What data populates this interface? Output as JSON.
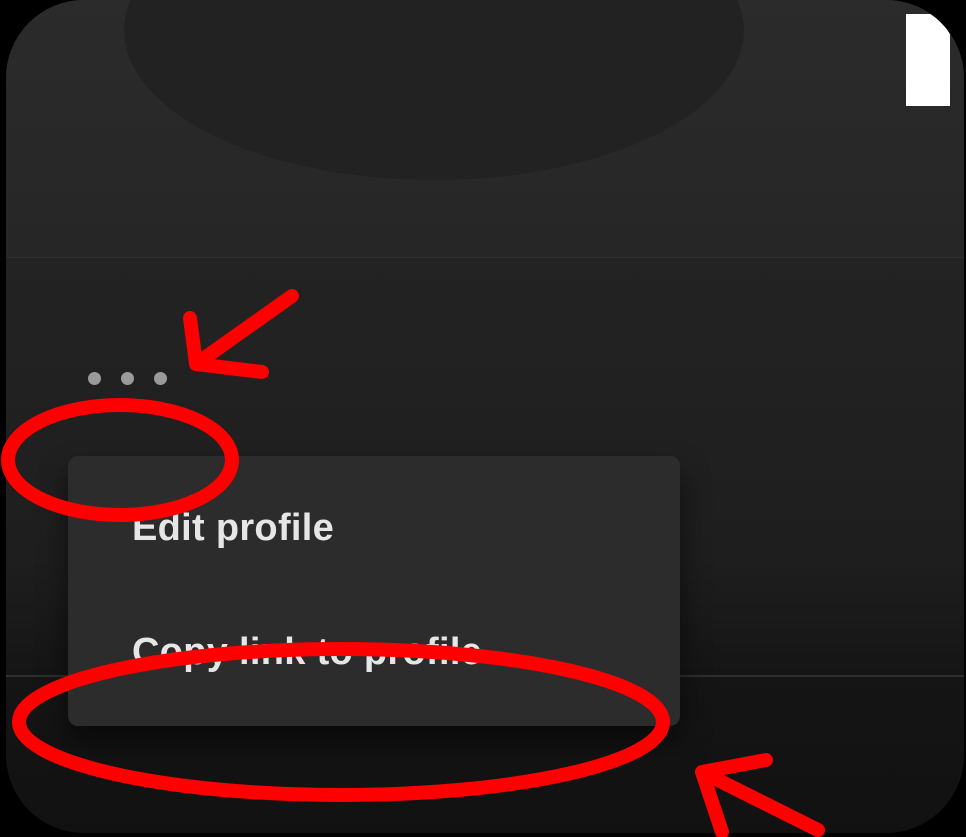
{
  "context_menu": {
    "items": [
      {
        "label": "Edit profile"
      },
      {
        "label": "Copy link to profile"
      }
    ]
  },
  "icons": {
    "more": "more-horizontal-icon"
  },
  "annotation_color": "#ff0000"
}
